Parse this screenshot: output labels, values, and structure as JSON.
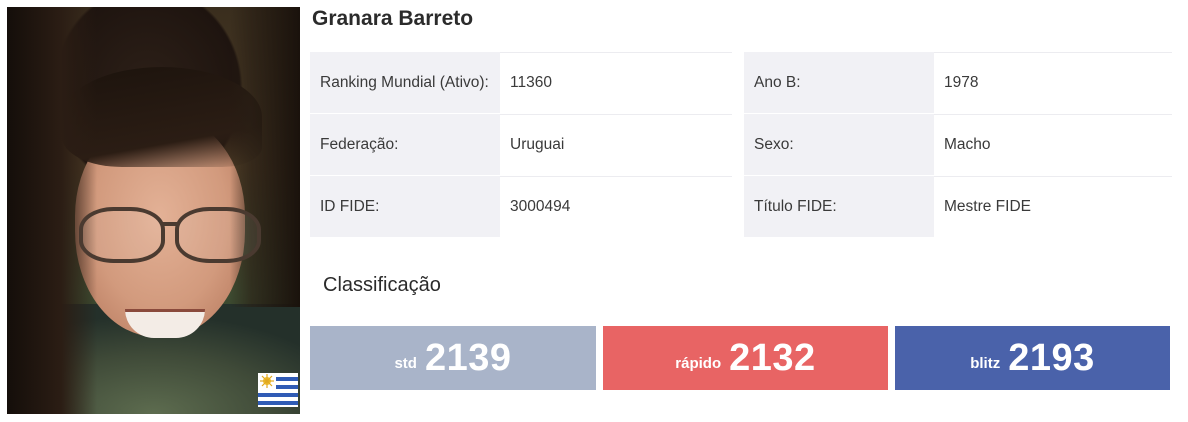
{
  "player": {
    "name": "Granara Barreto",
    "photo_alt": "player-photo",
    "flag": "uruguay-flag-icon"
  },
  "info": [
    {
      "label": "Ranking Mundial (Ativo):",
      "value": "11360",
      "label2": "Ano B:",
      "value2": "1978"
    },
    {
      "label": "Federação:",
      "value": "Uruguai",
      "label2": "Sexo:",
      "value2": "Macho"
    },
    {
      "label": "ID FIDE:",
      "value": "3000494",
      "label2": "Título FIDE:",
      "value2": "Mestre FIDE"
    }
  ],
  "ratings": {
    "title": "Classificação",
    "std": {
      "label": "std",
      "value": "2139",
      "color": "#a9b4c9"
    },
    "rapid": {
      "label": "rápido",
      "value": "2132",
      "color": "#e86464"
    },
    "blitz": {
      "label": "blitz",
      "value": "2193",
      "color": "#4a62aa"
    }
  }
}
